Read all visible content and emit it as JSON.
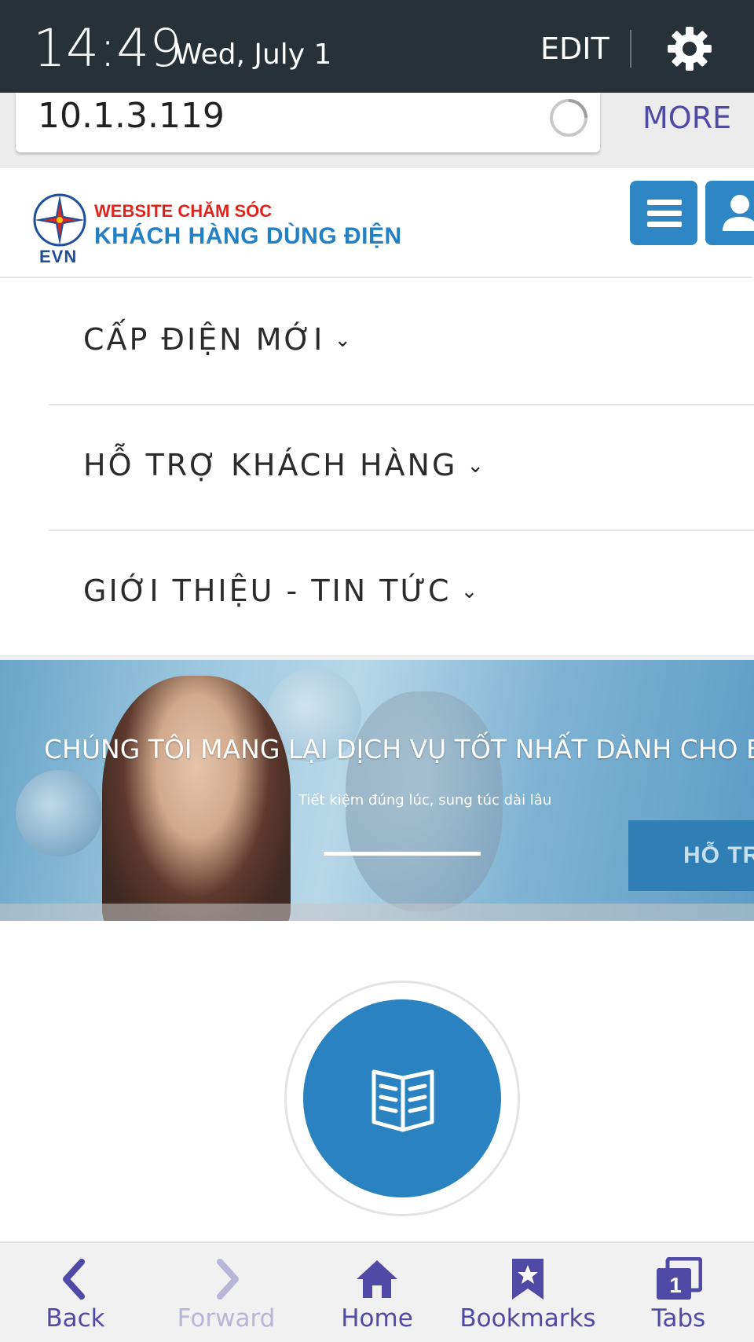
{
  "status_bar": {
    "time": "14:49",
    "date": "Wed, July 1",
    "edit_label": "EDIT",
    "settings_icon": "gear-icon"
  },
  "address_bar": {
    "url": "10.1.3.119",
    "more_label": "MORE",
    "reload_icon": "reload-icon"
  },
  "site": {
    "logo_text": "EVN",
    "subtitle": "WEBSITE CHĂM SÓC",
    "title": "KHÁCH HÀNG DÙNG ĐIỆN",
    "menu_icon": "hamburger-menu-icon",
    "user_icon": "user-icon",
    "accent_color": "#2e86c5",
    "brand_red": "#e0241b"
  },
  "nav": {
    "items": [
      {
        "label": "CẤP ĐIỆN MỚI"
      },
      {
        "label": "HỖ TRỢ KHÁCH HÀNG"
      },
      {
        "label": "GIỚI THIỆU - TIN TỨC"
      }
    ]
  },
  "banner": {
    "title": "CHÚNG TÔI MANG LẠI DỊCH VỤ TỐT NHẤT DÀNH CHO BẠN",
    "subtitle": "Tiết kiệm đúng lúc, sung túc dài lâu",
    "button_label": "HỖ TRỢ"
  },
  "feature": {
    "icon": "open-book-icon"
  },
  "toolbar": {
    "items": [
      {
        "label": "Back",
        "icon": "back-arrow-icon",
        "enabled": true
      },
      {
        "label": "Forward",
        "icon": "forward-arrow-icon",
        "enabled": false
      },
      {
        "label": "Home",
        "icon": "home-icon",
        "enabled": true
      },
      {
        "label": "Bookmarks",
        "icon": "bookmark-icon",
        "enabled": true
      },
      {
        "label": "Tabs",
        "icon": "tabs-icon",
        "enabled": true,
        "count": "1"
      }
    ]
  }
}
